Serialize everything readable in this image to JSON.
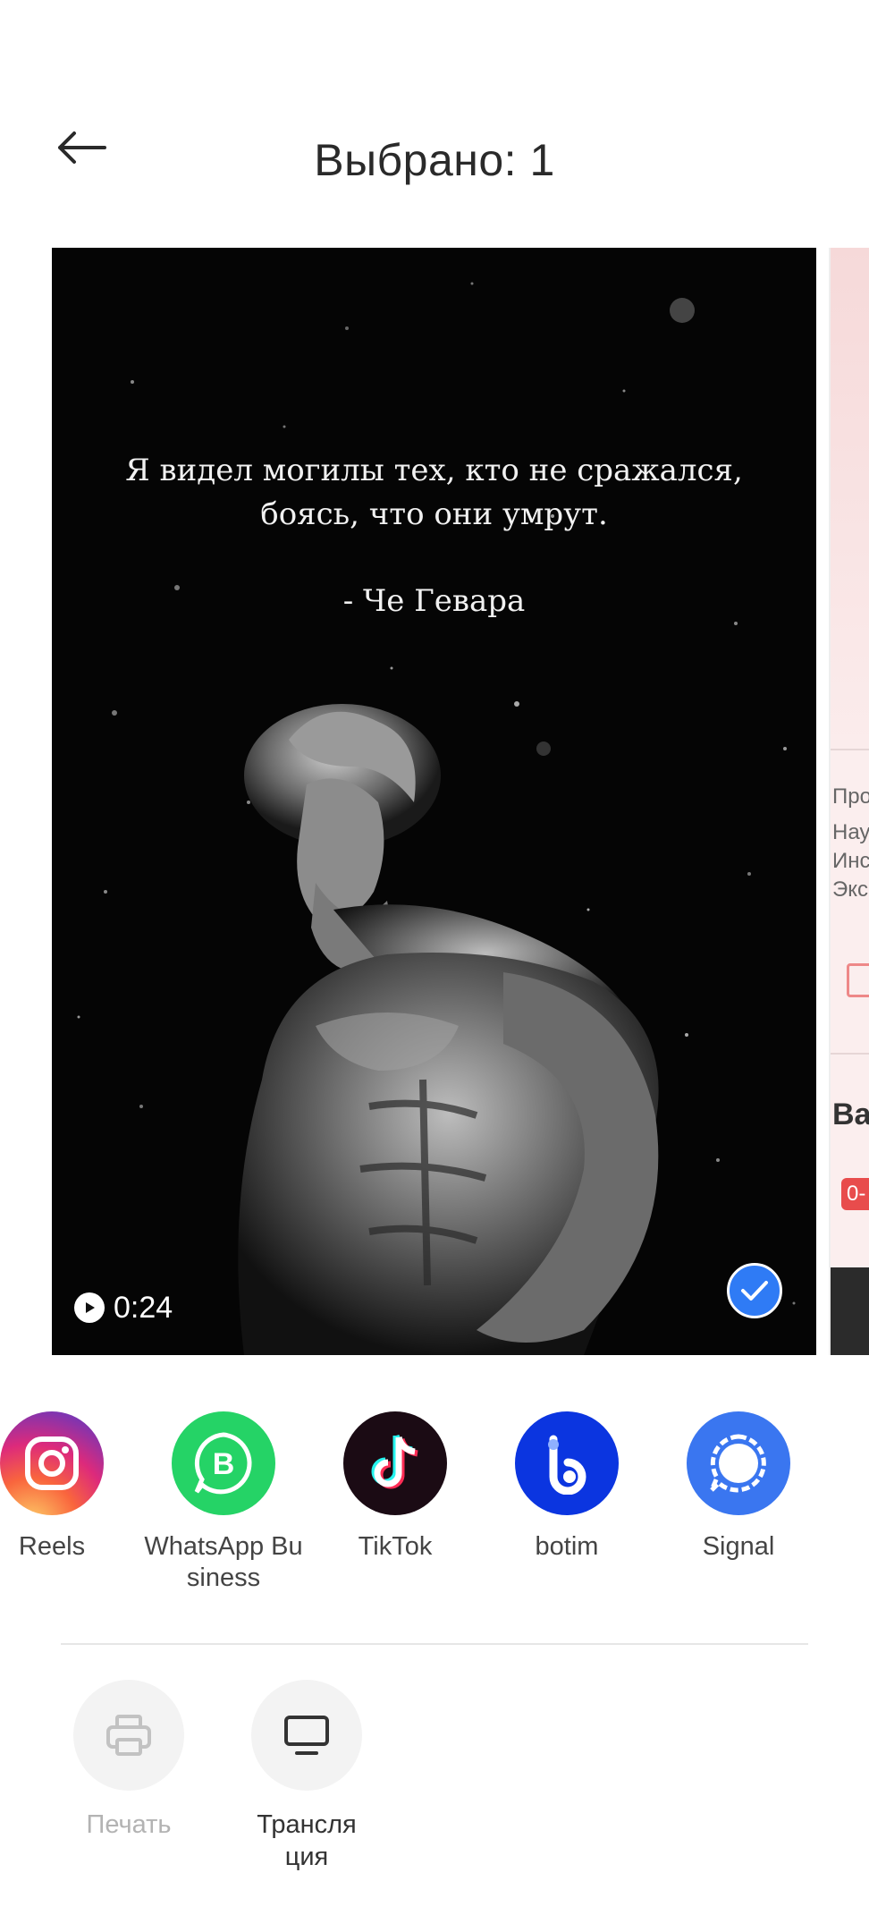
{
  "header": {
    "title": "Выбрано: 1",
    "back_icon": "arrow-left-icon"
  },
  "preview": {
    "quote_line1": "Я видел могилы тех, кто не сражался,",
    "quote_line2": "боясь, что они умрут.",
    "quote_author": "- Че Гевара",
    "duration": "0:24",
    "selected": true,
    "accent": "#2f7bf5"
  },
  "next_preview": {
    "text1": "Про",
    "text2": "Нау",
    "text3": "Инс",
    "text4": "Экс",
    "heading": "Вас",
    "badge": "0-"
  },
  "share_apps": [
    {
      "label": "Reels",
      "icon": "instagram-icon"
    },
    {
      "label": "WhatsApp Bu\nsiness",
      "icon": "whatsapp-business-icon"
    },
    {
      "label": "TikTok",
      "icon": "tiktok-icon"
    },
    {
      "label": "botim",
      "icon": "botim-icon"
    },
    {
      "label": "Signal",
      "icon": "signal-icon"
    }
  ],
  "actions": [
    {
      "label": "Печать",
      "icon": "printer-icon",
      "enabled": false
    },
    {
      "label": "Трансля\nция",
      "icon": "monitor-icon",
      "enabled": true
    }
  ]
}
